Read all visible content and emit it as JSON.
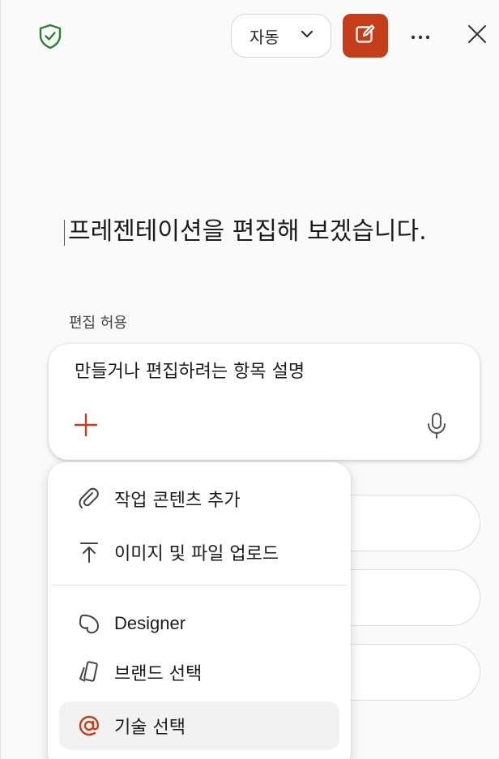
{
  "header": {
    "mode_select": {
      "value": "자동"
    },
    "compose_label": "",
    "more_label": "",
    "close_label": ""
  },
  "main": {
    "heading": "프레젠테이션을 편집해 보겠습니다.",
    "allow_label": "편집 허용",
    "prompt": {
      "placeholder": "만들거나 편집하려는 항목 설명"
    }
  },
  "menu": {
    "items": [
      {
        "label": "작업 콘텐츠 추가",
        "icon": "paperclip-icon"
      },
      {
        "label": "이미지 및 파일 업로드",
        "icon": "upload-icon"
      },
      {
        "label": "Designer",
        "icon": "designer-icon"
      },
      {
        "label": "브랜드 선택",
        "icon": "brand-icon"
      },
      {
        "label": "기술 선택",
        "icon": "at-icon"
      }
    ]
  },
  "colors": {
    "accent": "#c43e1c",
    "shield": "#2e7d32"
  }
}
